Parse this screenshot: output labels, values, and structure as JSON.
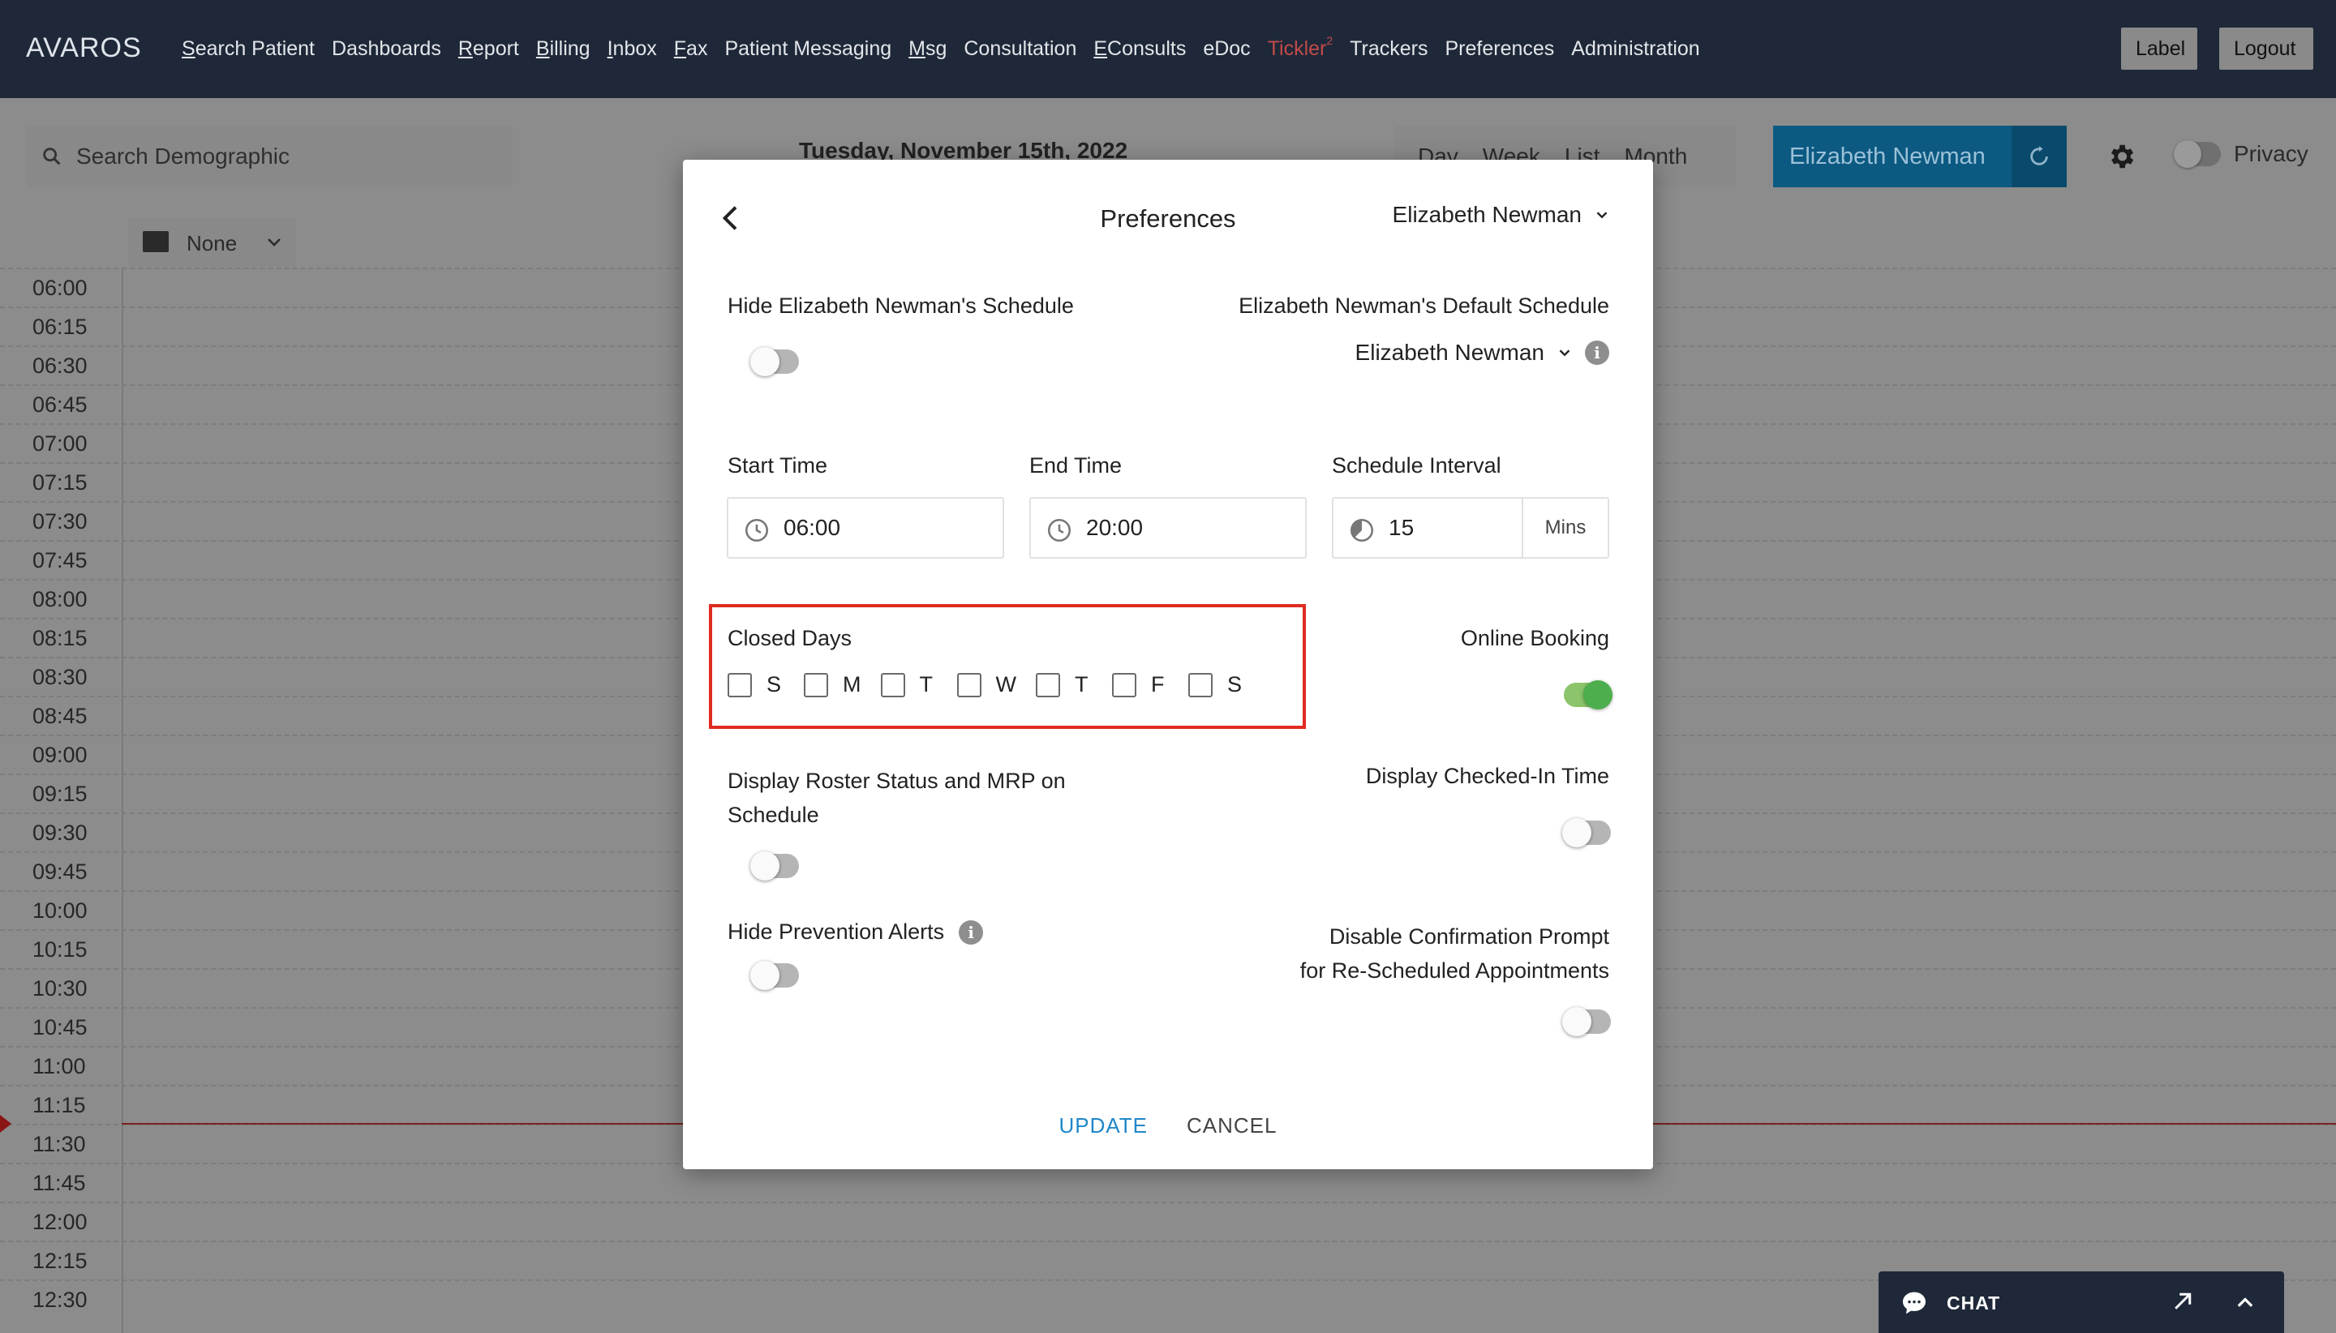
{
  "app": {
    "brand": "AVAROS",
    "nav": [
      {
        "label": "Search Patient",
        "u": "S",
        "rest": "earch Patient"
      },
      {
        "label": "Dashboards",
        "u": "",
        "rest": "Dashboards"
      },
      {
        "label": "Report",
        "u": "R",
        "rest": "eport"
      },
      {
        "label": "Billing",
        "u": "B",
        "rest": "illing"
      },
      {
        "label": "Inbox",
        "u": "I",
        "rest": "nbox"
      },
      {
        "label": "Fax",
        "u": "F",
        "rest": "ax"
      },
      {
        "label": "Patient Messaging",
        "u": "",
        "rest": "Patient Messaging"
      },
      {
        "label": "Msg",
        "u": "M",
        "rest": "sg"
      },
      {
        "label": "Consultation",
        "u": "",
        "rest": "Consultation"
      },
      {
        "label": "EConsults",
        "u": "E",
        "rest": "Consults"
      },
      {
        "label": "eDoc",
        "u": "",
        "rest": "eDoc"
      },
      {
        "label": "Tickler",
        "u": "",
        "rest": "Tickler"
      },
      {
        "label": "Trackers",
        "u": "",
        "rest": "Trackers"
      },
      {
        "label": "Preferences",
        "u": "",
        "rest": "Preferences"
      },
      {
        "label": "Administration",
        "u": "",
        "rest": "Administration"
      }
    ],
    "tickler_count": "2",
    "label_button": "Label",
    "logout_button": "Logout"
  },
  "schedule": {
    "search_placeholder": "Search Demographic",
    "date": "Tuesday, November 15th, 2022",
    "views": [
      "Day",
      "Week",
      "List",
      "Month"
    ],
    "provider": "Elizabeth Newman",
    "privacy_label": "Privacy",
    "filter_label": "None",
    "times": [
      "06:00",
      "06:15",
      "06:30",
      "06:45",
      "07:00",
      "07:15",
      "07:30",
      "07:45",
      "08:00",
      "08:15",
      "08:30",
      "08:45",
      "09:00",
      "09:15",
      "09:30",
      "09:45",
      "10:00",
      "10:15",
      "10:30",
      "10:45",
      "11:00",
      "11:15",
      "11:30",
      "11:45",
      "12:00",
      "12:15",
      "12:30"
    ]
  },
  "modal": {
    "title": "Preferences",
    "provider": "Elizabeth Newman",
    "hide_schedule_label": "Hide Elizabeth Newman's Schedule",
    "hide_schedule_on": false,
    "default_schedule_label": "Elizabeth Newman's Default Schedule",
    "default_schedule_value": "Elizabeth Newman",
    "start_time_label": "Start Time",
    "start_time_value": "06:00",
    "end_time_label": "End Time",
    "end_time_value": "20:00",
    "interval_label": "Schedule Interval",
    "interval_value": "15",
    "interval_unit": "Mins",
    "closed_days_label": "Closed Days",
    "closed_days": [
      {
        "day": "S",
        "checked": false
      },
      {
        "day": "M",
        "checked": false
      },
      {
        "day": "T",
        "checked": false
      },
      {
        "day": "W",
        "checked": false
      },
      {
        "day": "T",
        "checked": false
      },
      {
        "day": "F",
        "checked": false
      },
      {
        "day": "S",
        "checked": false
      }
    ],
    "online_booking_label": "Online Booking",
    "online_booking_on": true,
    "roster_label_line1": "Display Roster Status and MRP on",
    "roster_label_line2": "Schedule",
    "roster_on": false,
    "checked_in_label": "Display Checked-In Time",
    "checked_in_on": false,
    "prevention_label": "Hide Prevention Alerts",
    "prevention_on": false,
    "confirm_label_line1": "Disable Confirmation Prompt",
    "confirm_label_line2": "for Re-Scheduled Appointments",
    "confirm_on": false,
    "update_button": "UPDATE",
    "cancel_button": "CANCEL"
  },
  "chat": {
    "label": "CHAT"
  },
  "colors": {
    "nav_bg": "#1e2838",
    "accent_blue": "#1f87c9",
    "highlight_red": "#e02b20",
    "toggle_on": "#4cae4c"
  }
}
